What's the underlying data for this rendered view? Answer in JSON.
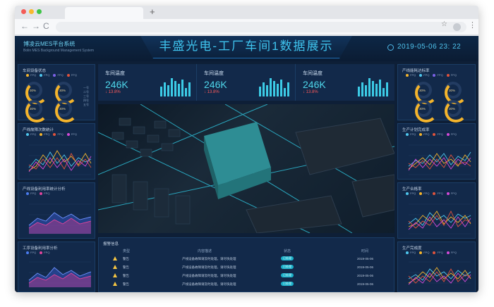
{
  "browser": {
    "new_tab": "+",
    "back": "←",
    "forward": "→",
    "reload": "C",
    "star": "☆",
    "menu": "⋮"
  },
  "header": {
    "brand": "博凌云MES平台系统",
    "brand_sub": "Bolin MES Background Management System",
    "title": "丰盛光电-工厂车间1数据展示",
    "clock": "2019-05-06 23: 22"
  },
  "left": {
    "p1": {
      "title": "车间设备状态",
      "legend": [
        "FPQ",
        "FPQ",
        "FPQ",
        "FPQ"
      ],
      "gauges": [
        "30%",
        "30%",
        "30%",
        "30%"
      ],
      "side_legend": [
        "一号",
        "二号",
        "三号",
        "四号",
        "五号"
      ]
    },
    "p2": {
      "title": "产线故障次数统计",
      "legend": [
        "FPQ",
        "FPQ",
        "FPQ",
        "FPQ"
      ]
    },
    "p3": {
      "title": "产线设备利用率统计分析",
      "legend": [
        "FPQ",
        "FPQ"
      ]
    },
    "p4": {
      "title": "工序设备利用率分析",
      "legend": [
        "FPQ",
        "FPQ"
      ]
    }
  },
  "stats": [
    {
      "title": "车间温度",
      "value": "246K",
      "pct": "↓ 13.8%"
    },
    {
      "title": "车间温度",
      "value": "246K",
      "pct": "↓ 13.8%"
    },
    {
      "title": "车间温度",
      "value": "246K",
      "pct": "↓ 13.8%"
    }
  ],
  "right": {
    "p1": {
      "title": "产线能耗达标率",
      "legend": [
        "FPQ",
        "FPQ",
        "FPQ",
        "FPQ"
      ],
      "gauges": [
        "30%",
        "30%",
        "30%",
        "30%"
      ]
    },
    "p2": {
      "title": "生产计划完成率",
      "legend": [
        "FPQ",
        "FPQ",
        "FPQ",
        "FPQ"
      ]
    },
    "p3": {
      "title": "生产合格率",
      "legend": [
        "FPQ",
        "FPQ",
        "FPQ",
        "FPQ"
      ]
    },
    "p4": {
      "title": "生产完成度",
      "legend": [
        "FPQ",
        "FPQ",
        "FPQ",
        "FPQ"
      ]
    }
  },
  "alarm": {
    "title": "报警信息",
    "headers": [
      "类型",
      "内容描述",
      "状态",
      "时间"
    ],
    "rows": [
      {
        "type": "警告",
        "desc": "产线设备故障请及时处理，请尽快处理",
        "status": "已处理",
        "time": "2019-05-06"
      },
      {
        "type": "警告",
        "desc": "产线设备故障请及时处理，请尽快处理",
        "status": "已处理",
        "time": "2019-05-06"
      },
      {
        "type": "警告",
        "desc": "产线设备故障请及时处理，请尽快处理",
        "status": "已处理",
        "time": "2019-05-06"
      },
      {
        "type": "警告",
        "desc": "产线设备故障请及时处理，请尽快处理",
        "status": "已处理",
        "time": "2019-05-06"
      }
    ]
  },
  "colors": {
    "accent": "#3fc4ee",
    "bg": "#0e1f37",
    "panel": "#12294a",
    "warn": "#f5c542",
    "down": "#ff5a5a"
  }
}
